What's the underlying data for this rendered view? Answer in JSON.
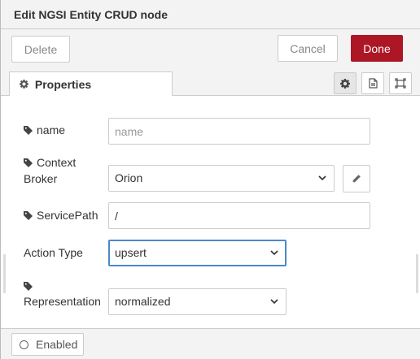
{
  "tray": {
    "title": "Edit NGSI Entity CRUD node"
  },
  "toolbar": {
    "delete_label": "Delete",
    "cancel_label": "Cancel",
    "done_label": "Done"
  },
  "tabs": {
    "properties_label": "Properties",
    "icons": [
      "gear-icon",
      "description-icon",
      "appearance-icon"
    ]
  },
  "form": {
    "name": {
      "label": "name",
      "placeholder": "name",
      "value": ""
    },
    "context_broker": {
      "label_line1": "Context",
      "label_line2": "Broker",
      "value": "Orion"
    },
    "service_path": {
      "label": "ServicePath",
      "value": "/"
    },
    "action_type": {
      "label": "Action Type",
      "value": "upsert"
    },
    "representation": {
      "label": "Representation",
      "value": "normalized"
    }
  },
  "footer": {
    "enabled_label": "Enabled"
  },
  "colors": {
    "done": "#ad1625",
    "focus": "#4a8ac9"
  }
}
